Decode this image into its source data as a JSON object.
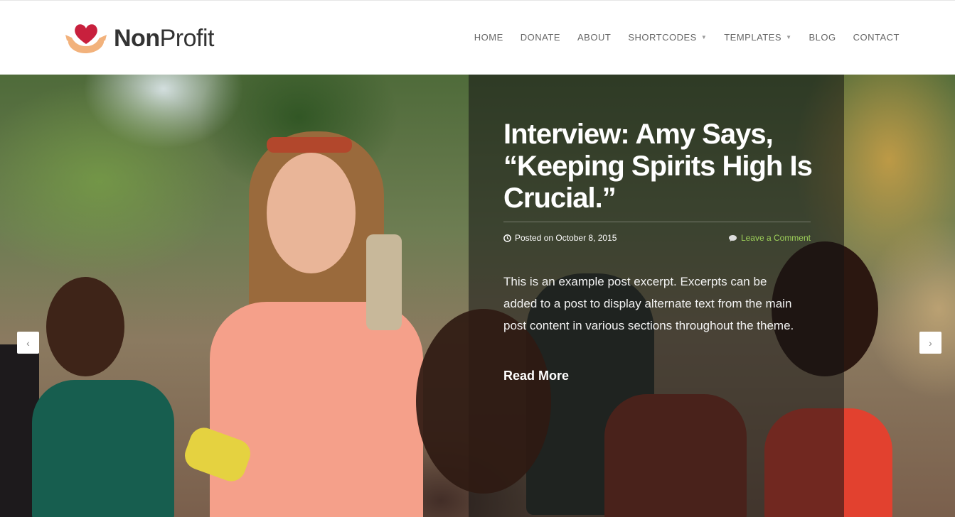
{
  "brand": {
    "name_bold": "Non",
    "name_regular": "Profit",
    "icon": "heart-hands-icon",
    "heart_color": "#c8203d",
    "hands_color": "#f2b27c"
  },
  "nav": {
    "items": [
      {
        "label": "HOME",
        "dropdown": false
      },
      {
        "label": "DONATE",
        "dropdown": false
      },
      {
        "label": "ABOUT",
        "dropdown": false
      },
      {
        "label": "SHORTCODES",
        "dropdown": true
      },
      {
        "label": "TEMPLATES",
        "dropdown": true
      },
      {
        "label": "BLOG",
        "dropdown": false
      },
      {
        "label": "CONTACT",
        "dropdown": false
      }
    ]
  },
  "slide": {
    "title_bold": "Interview:",
    "title_rest": " Amy Says, “Keeping Spirits High Is Crucial.”",
    "posted_on": "Posted on October 8, 2015",
    "comment_link": "Leave a Comment",
    "excerpt": "This is an example post excerpt. Excerpts can be added to a post to display alternate text from the main post content in various sections throughout the theme.",
    "read_more": "Read More",
    "accent_color": "#9ed15a"
  },
  "slider": {
    "prev_symbol": "‹",
    "next_symbol": "›"
  }
}
